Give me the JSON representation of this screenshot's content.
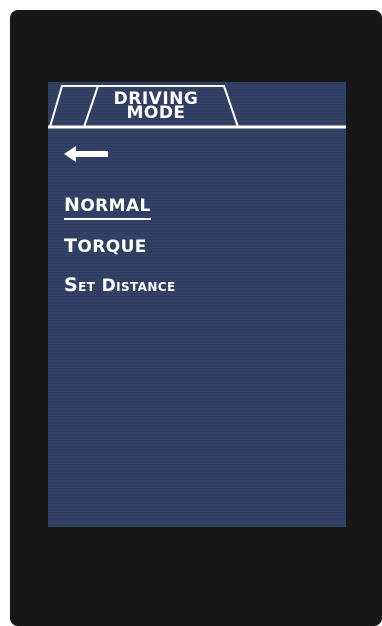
{
  "header": {
    "title_line1": "DRIVING",
    "title_line2": "MODE"
  },
  "icons": {
    "back": "left-arrow-icon"
  },
  "menu": {
    "items": [
      {
        "label": "Normal",
        "selected": true
      },
      {
        "label": "Torque",
        "selected": false
      },
      {
        "label": "Set Distance",
        "selected": false
      }
    ]
  },
  "colors": {
    "screen_background": "#2e3e63",
    "bezel": "#171717",
    "foreground": "#ffffff"
  }
}
